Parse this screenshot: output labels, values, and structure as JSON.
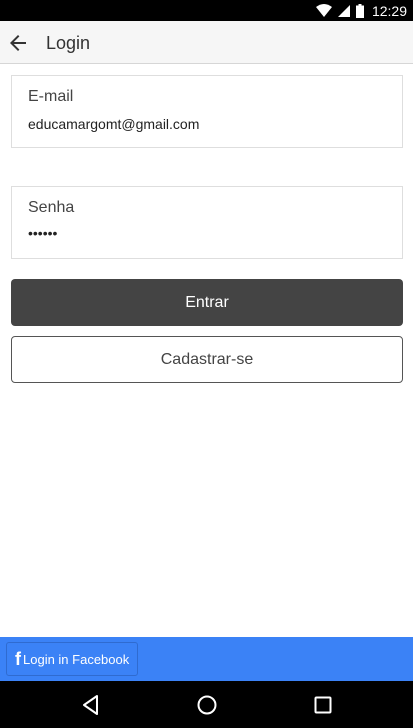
{
  "status_bar": {
    "time": "12:29",
    "icons": [
      "wifi-icon",
      "signal-icon",
      "battery-icon"
    ]
  },
  "app_bar": {
    "title": "Login",
    "back_icon": "arrow-left-icon"
  },
  "form": {
    "email": {
      "label": "E-mail",
      "value": "educamargomt@gmail.com"
    },
    "password": {
      "label": "Senha",
      "masked_value": "••••••"
    },
    "submit_label": "Entrar",
    "register_label": "Cadastrar-se"
  },
  "footer": {
    "facebook_icon_glyph": "f",
    "facebook_label": "Login in Facebook"
  },
  "nav_bar": {
    "icons": [
      "nav-back-icon",
      "nav-home-icon",
      "nav-recents-icon"
    ]
  },
  "colors": {
    "primary_button": "#444444",
    "footer_bar": "#3b82f6",
    "status_bar": "#000000",
    "app_bar": "#f6f6f6"
  }
}
